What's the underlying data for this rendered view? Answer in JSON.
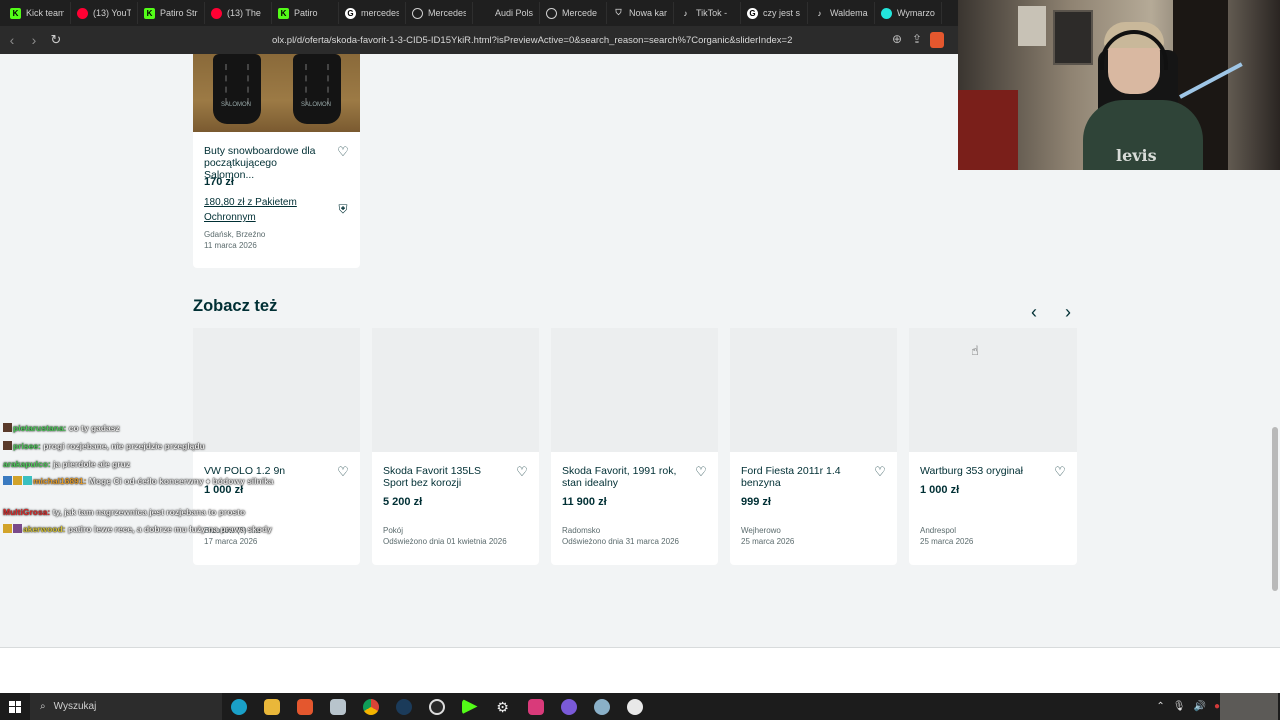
{
  "browser": {
    "tabs": [
      {
        "label": "Kick team",
        "icon": "kick-icon",
        "color": "#53fc18"
      },
      {
        "label": "(13) YouT",
        "icon": "youtube-icon",
        "color": "#ff0033"
      },
      {
        "label": "Patiro Str",
        "icon": "kick-icon",
        "color": "#53fc18"
      },
      {
        "label": "(13) The",
        "icon": "youtube-icon",
        "color": "#ff0033"
      },
      {
        "label": "Patiro",
        "icon": "kick-icon",
        "color": "#53fc18"
      },
      {
        "label": "mercedes",
        "icon": "google-icon",
        "color": "#ffffff"
      },
      {
        "label": "Mercedes",
        "icon": "mercedes-icon",
        "color": "#cfcfcf"
      },
      {
        "label": "Audi Pols",
        "icon": "audi-icon",
        "color": "#1f1f1f"
      },
      {
        "label": "Mercede",
        "icon": "mercedes-icon",
        "color": "#cfcfcf"
      },
      {
        "label": "Nowa kar",
        "icon": "shield-icon",
        "color": "#cfcfcf"
      },
      {
        "label": "TikTok -",
        "icon": "tiktok-icon",
        "color": "#1f1f1f"
      },
      {
        "label": "czy jest s",
        "icon": "google-icon",
        "color": "#ffffff"
      },
      {
        "label": "Waldema",
        "icon": "tiktok-icon",
        "color": "#1f1f1f"
      },
      {
        "label": "Wymarzo",
        "icon": "olx-icon",
        "color": "#23e5db"
      }
    ],
    "url": "olx.pl/d/oferta/skoda-favorit-1-3-CID5-ID15YkiR.html?isPreviewActive=0&search_reason=search%7Corganic&sliderIndex=2"
  },
  "listing_top": {
    "title": "Buty snowboardowe dla początkującego Salomon...",
    "price": "170 zł",
    "protect": "180,80 zł z Pakietem Ochronnym",
    "location": "Gdańsk, Brzeźno",
    "date": "11 marca 2026"
  },
  "see_also": {
    "title": "Zobacz też",
    "items": [
      {
        "title": "VW POLO 1.2 9n",
        "price": "1 000 zł",
        "location": "Brzozów (?) ...a",
        "date": "17 marca 2026"
      },
      {
        "title": "Skoda Favorit 135LS Sport bez korozji",
        "price": "5 200 zł",
        "location": "Pokój",
        "date": "Odświeżono dnia 01 kwietnia 2026"
      },
      {
        "title": "Skoda Favorit, 1991 rok, stan idealny",
        "price": "11 900 zł",
        "location": "Radomsko",
        "date": "Odświeżono dnia 31 marca 2026"
      },
      {
        "title": "Ford Fiesta 2011r 1.4 benzyna",
        "price": "999 zł",
        "location": "Wejherowo",
        "date": "25 marca 2026"
      },
      {
        "title": "Wartburg 353 oryginał",
        "price": "1 000 zł",
        "location": "Andrespol",
        "date": "25 marca 2026"
      }
    ]
  },
  "chat": [
    {
      "user": "pietarustana:",
      "msg": "co ty gadasz",
      "color": "green"
    },
    {
      "user": "prisee:",
      "msg": "progi rozjebane, nie przejdzie przeglądu",
      "color": "green"
    },
    {
      "user": "arakapulco:",
      "msg": "ja pierdole ale gruz",
      "color": "green"
    },
    {
      "user": "michal16891:",
      "msg": "Mogę Ci od-ćełlo koncerwny ♦ bódowy silnika",
      "color": "orange"
    },
    {
      "user": "MultiGrosa:",
      "msg": "ty, jak tam nagrzewnica jest rozjebana to prosto",
      "color": "red"
    },
    {
      "user": "akerwood:",
      "msg": "patiro lewe rece, a dobrze mu łuży na prawa skody",
      "color": "yellow"
    }
  ],
  "taskbar": {
    "search_placeholder": "Wyszukaj",
    "apps": [
      "edge-icon",
      "explorer-icon",
      "brave-icon",
      "notepad-icon",
      "chrome-icon",
      "steam-icon",
      "obs-icon",
      "kick-app-icon",
      "settings-icon",
      "spotify-icon",
      "discord-icon",
      "app-icon",
      "chatgpt-icon"
    ]
  }
}
